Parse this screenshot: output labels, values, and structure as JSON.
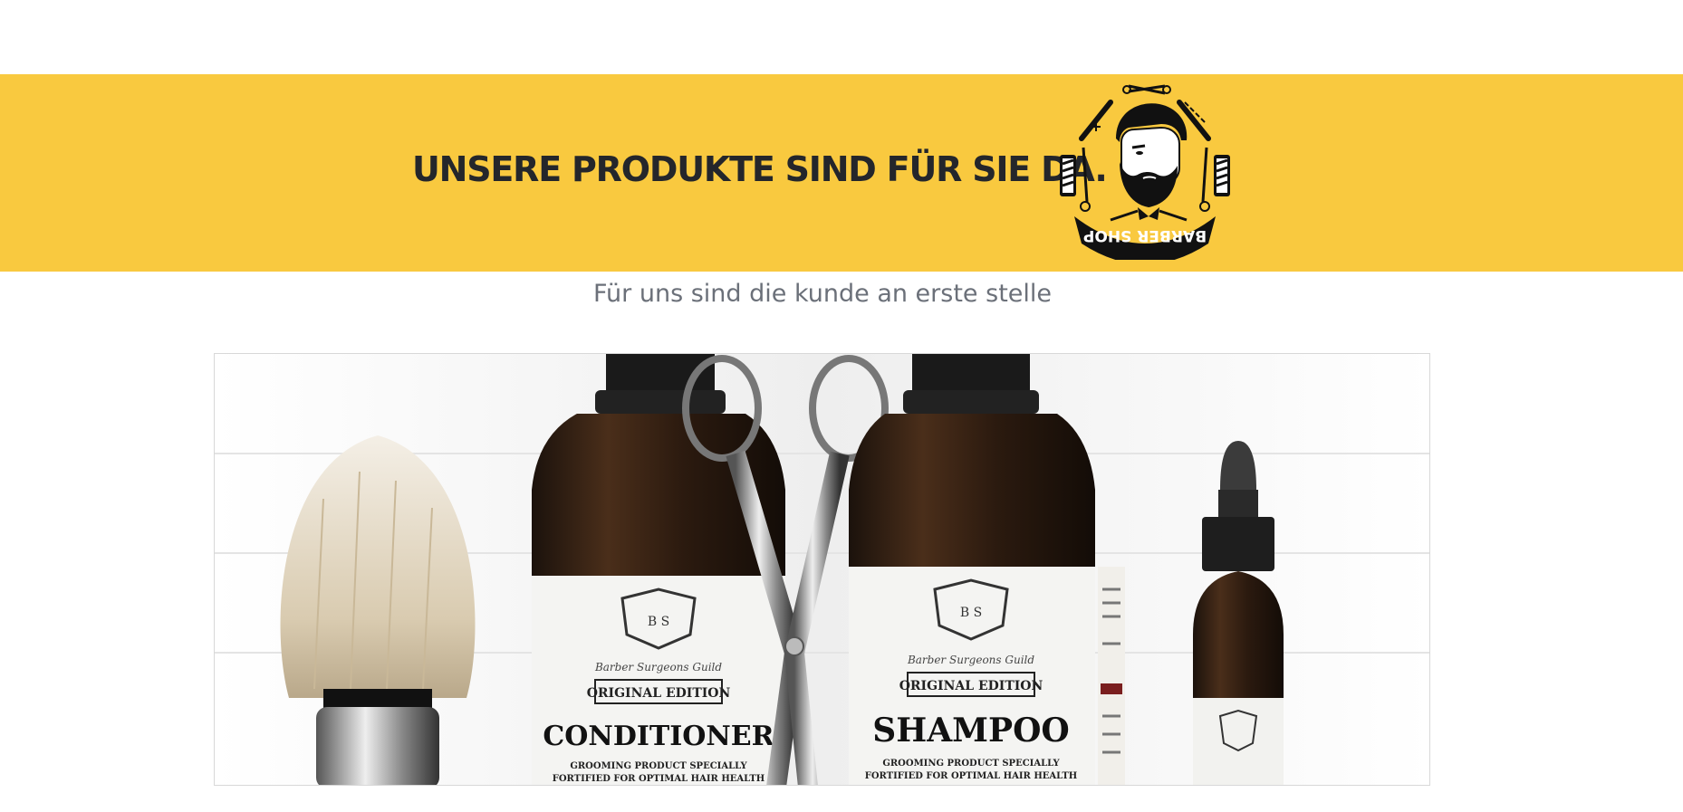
{
  "banner": {
    "headline": "UNSERE PRODUKTE SIND FÜR SIE DA.",
    "background_color": "#f9c93f",
    "logo": {
      "icon": "barber-shop-logo",
      "text": "BARBER SHOP"
    }
  },
  "tagline": "Für uns sind die kunde an erste stelle",
  "hero_image": {
    "icon": "barber-products-photo",
    "products": [
      {
        "edition": "ORIGINAL EDITION",
        "name": "CONDITIONER",
        "desc_1": "GROOMING PRODUCT SPECIALLY",
        "desc_2": "FORTIFIED FOR OPTIMAL HAIR HEALTH",
        "brand": "Barber Surgeons Guild"
      },
      {
        "edition": "ORIGINAL EDITION",
        "name": "SHAMPOO",
        "desc_1": "GROOMING PRODUCT SPECIALLY",
        "desc_2": "FORTIFIED FOR OPTIMAL HAIR HEALTH",
        "brand": "Barber Surgeons Guild"
      }
    ]
  }
}
